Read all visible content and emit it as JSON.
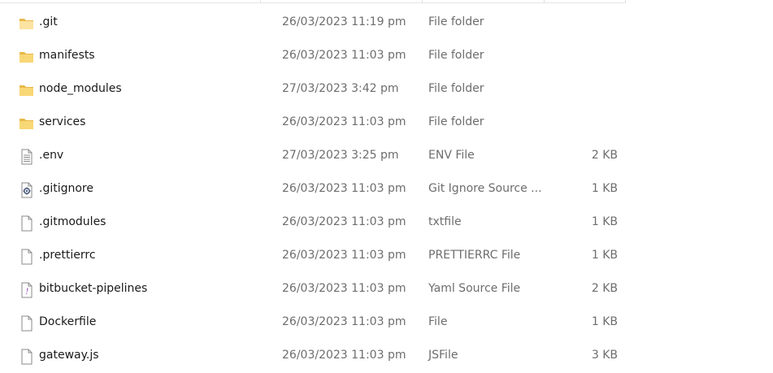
{
  "files": [
    {
      "name": ".git",
      "date": "26/03/2023 11:19 pm",
      "type": "File folder",
      "size": "",
      "icon": "folder-open-icon"
    },
    {
      "name": "manifests",
      "date": "26/03/2023 11:03 pm",
      "type": "File folder",
      "size": "",
      "icon": "folder-icon"
    },
    {
      "name": "node_modules",
      "date": "27/03/2023 3:42 pm",
      "type": "File folder",
      "size": "",
      "icon": "folder-icon"
    },
    {
      "name": "services",
      "date": "26/03/2023 11:03 pm",
      "type": "File folder",
      "size": "",
      "icon": "folder-icon"
    },
    {
      "name": ".env",
      "date": "27/03/2023 3:25 pm",
      "type": "ENV File",
      "size": "2 KB",
      "icon": "text-file-icon"
    },
    {
      "name": ".gitignore",
      "date": "26/03/2023 11:03 pm",
      "type": "Git Ignore Source ...",
      "size": "1 KB",
      "icon": "config-file-icon"
    },
    {
      "name": ".gitmodules",
      "date": "26/03/2023 11:03 pm",
      "type": "txtfile",
      "size": "1 KB",
      "icon": "blank-file-icon"
    },
    {
      "name": ".prettierrc",
      "date": "26/03/2023 11:03 pm",
      "type": "PRETTIERRC File",
      "size": "1 KB",
      "icon": "blank-file-icon"
    },
    {
      "name": "bitbucket-pipelines",
      "date": "26/03/2023 11:03 pm",
      "type": "Yaml Source File",
      "size": "2 KB",
      "icon": "yaml-file-icon"
    },
    {
      "name": "Dockerfile",
      "date": "26/03/2023 11:03 pm",
      "type": "File",
      "size": "1 KB",
      "icon": "blank-file-icon"
    },
    {
      "name": "gateway.js",
      "date": "26/03/2023 11:03 pm",
      "type": "JSFile",
      "size": "3 KB",
      "icon": "blank-file-icon"
    }
  ],
  "colors": {
    "folder": "#F8D775",
    "folder_dark": "#E8B84A",
    "file_outline": "#8a8a8a",
    "yaml_accent": "#8b3fbf"
  }
}
